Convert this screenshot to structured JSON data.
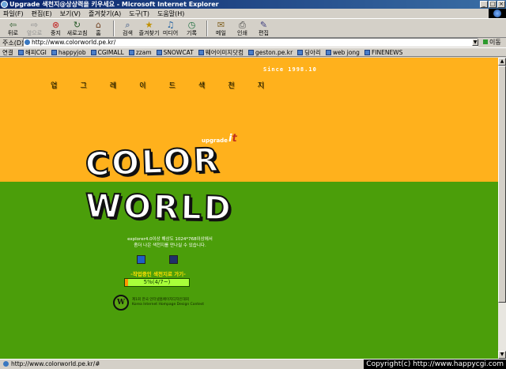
{
  "window": {
    "title": "Upgrade 색천지@상상력을 키우세요 - Microsoft Internet Explorer",
    "buttons": {
      "minimize": "_",
      "maximize": "□",
      "close": "×"
    }
  },
  "menu": {
    "items": [
      "파일(F)",
      "편집(E)",
      "보기(V)",
      "즐겨찾기(A)",
      "도구(T)",
      "도움말(H)"
    ]
  },
  "toolbar": {
    "back": "뒤로",
    "forward": "앞으로",
    "stop": "중지",
    "refresh": "새로고침",
    "home": "홈",
    "search": "검색",
    "favorites": "즐겨찾기",
    "media": "미디어",
    "history": "기록",
    "mail": "메일",
    "print": "인쇄",
    "edit": "편집"
  },
  "address": {
    "label": "주소(D)",
    "url": "http://www.colorworld.pe.kr/",
    "go": "이동"
  },
  "links": {
    "label": "연결",
    "items": [
      "해피CGI",
      "happyjob",
      "CGIMALL",
      "zzam",
      "SNOWCAT",
      "웨어이미지닷컴",
      "geston.pe.kr",
      "딩아리",
      "web jong",
      "FINENEWS"
    ]
  },
  "page": {
    "since": "Since 1998.10",
    "korean_title": [
      "업",
      "그",
      "레",
      "이",
      "드",
      "색",
      "천",
      "지"
    ],
    "upgrade": "upgrade",
    "color_word": "COLOR",
    "world_word": "WORLD",
    "desc_line1": "explorer4.0이상 해상도 1024*768이상에서",
    "desc_line2": "좀더 나은 색천지를 만나실 수 있습니다.",
    "progress_label": "-작업중인 색천지로 가기-",
    "progress_text": "5%(4/7~)",
    "progress_value": 0.05,
    "contest_line1": "제1회 한국 인터넷홈페이지디자인대회",
    "contest_line2": "Korea Internet Hompage Design Contest",
    "contest_badge": "W"
  },
  "status": {
    "text": "http://www.colorworld.pe.kr/#",
    "copyright": "Copyright(c) http://www.happycgi.com"
  },
  "colors": {
    "top_band": "#ffb11c",
    "bottom_band": "#4b9e0a",
    "progress_fill": "#ff9400",
    "progress_track": "#a8ff3a"
  }
}
